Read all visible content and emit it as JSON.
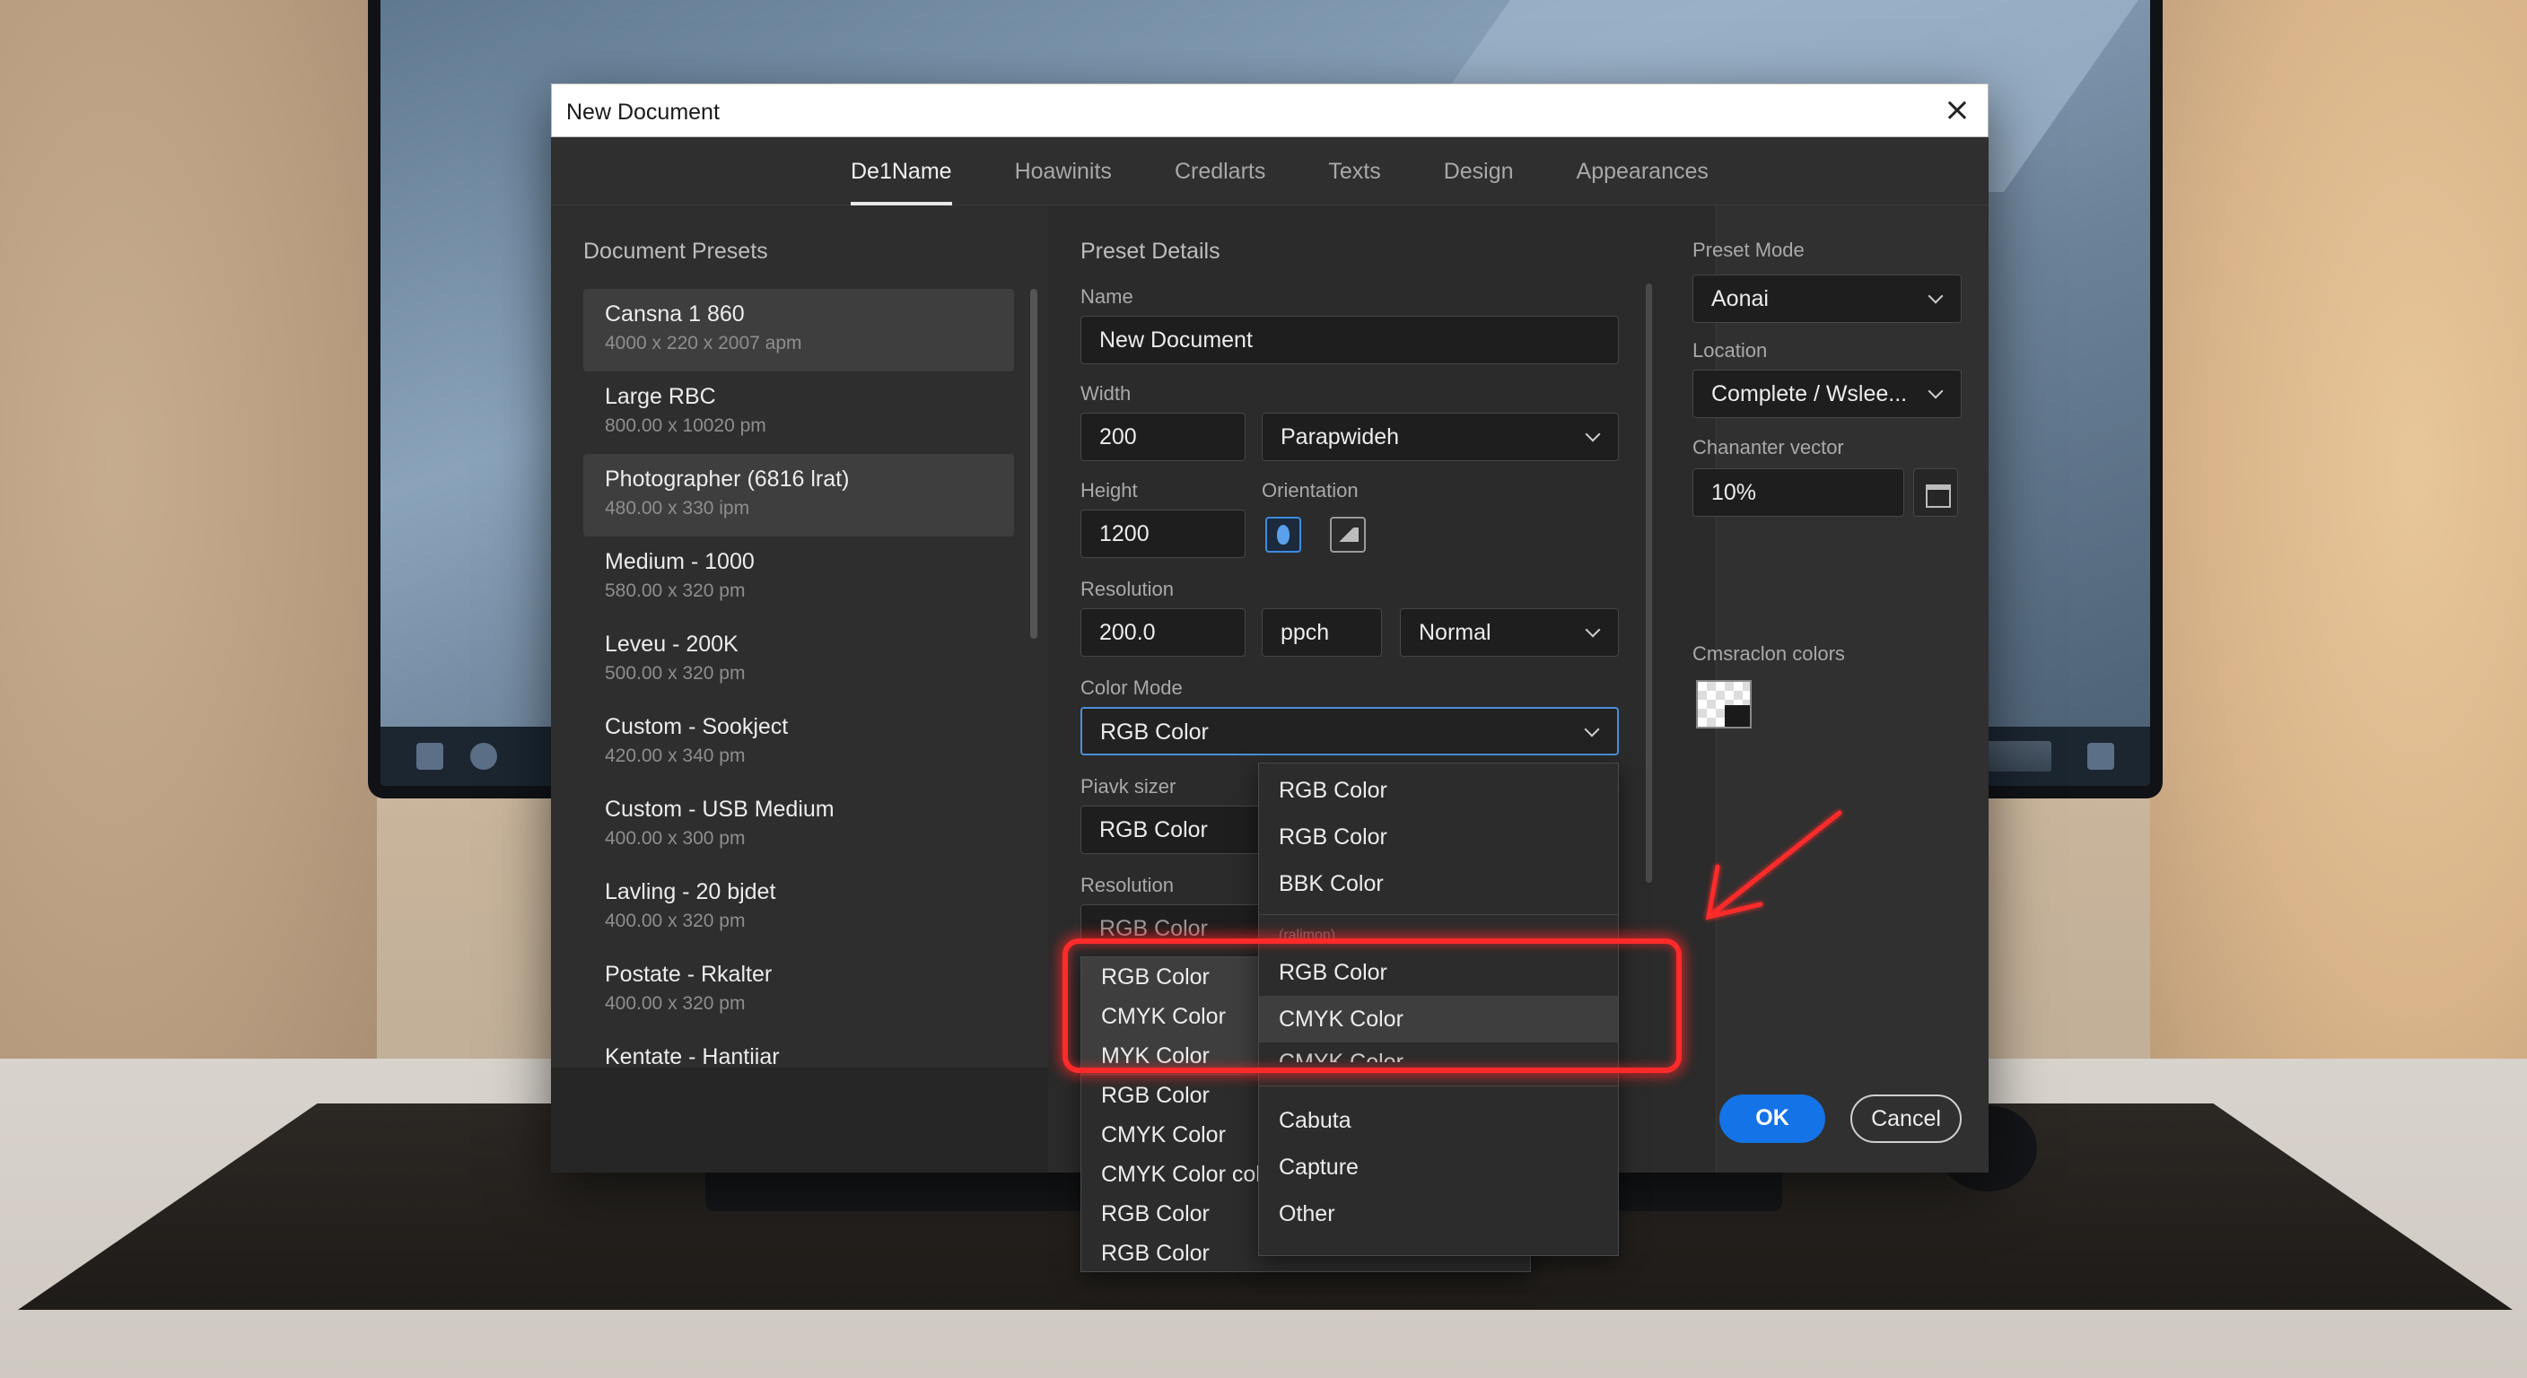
{
  "dialog": {
    "title": "New Document",
    "close_glyph": "×",
    "tabs": [
      {
        "label": "De1Name",
        "active": true
      },
      {
        "label": "Hoawinits",
        "active": false
      },
      {
        "label": "Credlarts",
        "active": false
      },
      {
        "label": "Texts",
        "active": false
      },
      {
        "label": "Design",
        "active": false
      },
      {
        "label": "Appearances",
        "active": false
      }
    ]
  },
  "presets": {
    "heading": "Document Presets",
    "items": [
      {
        "name": "Cansna 1 860",
        "dims": "4000 x 220 x 2007 apm",
        "selected": true
      },
      {
        "name": "Large RBC",
        "dims": "800.00 x 10020 pm",
        "selected": false
      },
      {
        "name": "Photographer (6816 lrat)",
        "dims": "480.00 x 330 ipm",
        "selected": true
      },
      {
        "name": "Medium - 1000",
        "dims": "580.00 x 320 pm",
        "selected": false
      },
      {
        "name": "Leveu - 200K",
        "dims": "500.00 x 320 pm",
        "selected": false
      },
      {
        "name": "Custom - Sookject",
        "dims": "420.00 x 340 pm",
        "selected": false
      },
      {
        "name": "Custom - USB Medium",
        "dims": "400.00 x 300 pm",
        "selected": false
      },
      {
        "name": "Lavling - 20 bjdet",
        "dims": "400.00 x 320 pm",
        "selected": false
      },
      {
        "name": "Postate - Rkalter",
        "dims": "400.00 x 320 pm",
        "selected": false
      },
      {
        "name": "Kentate - Hantiiar",
        "dims": "",
        "selected": false
      }
    ]
  },
  "details": {
    "heading": "Preset Details",
    "name_label": "Name",
    "name_value": "New Document",
    "width_label": "Width",
    "width_value": "200",
    "width_unit": "Parapwideh",
    "height_label": "Height",
    "height_value": "1200",
    "orientation_label": "Orientation",
    "resolution_label": "Resolution",
    "resolution_value": "200.0",
    "resolution_unit": "ppch",
    "resolution_mode": "Normal",
    "color_mode_label": "Color Mode",
    "color_mode_value": "RGB Color",
    "pixel_label": "Piavk sizer",
    "pixel_value": "RGB Color",
    "resolution2_label": "Resolution",
    "resolution2_value": "RGB Color"
  },
  "left_menu": {
    "items": [
      "RGB Color",
      "CMYK Color",
      "MYK Color",
      "RGB Color",
      "CMYK Color",
      "CMYK Color colc",
      "RGB Color",
      "RGB Color"
    ]
  },
  "right_menu": {
    "top_items": [
      "RGB Color",
      "RGB Color",
      "BBK Color"
    ],
    "ghost_item": "(ralimon)",
    "mid_items": [
      "RGB Color",
      "CMYK Color"
    ],
    "cut_item": "CMYK Color",
    "bottom_items": [
      "Cabuta",
      "Capture",
      "Other"
    ]
  },
  "right_panel": {
    "preset_mode_label": "Preset Mode",
    "preset_mode_value": "Aonai",
    "location_label": "Location",
    "location_value": "Complete / Wslee...",
    "vector_label": "Chananter vector",
    "vector_value": "10%",
    "colors_label": "Cmsraclon colors"
  },
  "buttons": {
    "ok": "OK",
    "cancel": "Cancel"
  },
  "colors": {
    "accent": "#1473e6",
    "focus_border": "#4a8fd8",
    "annotation": "#ff2a2a"
  }
}
